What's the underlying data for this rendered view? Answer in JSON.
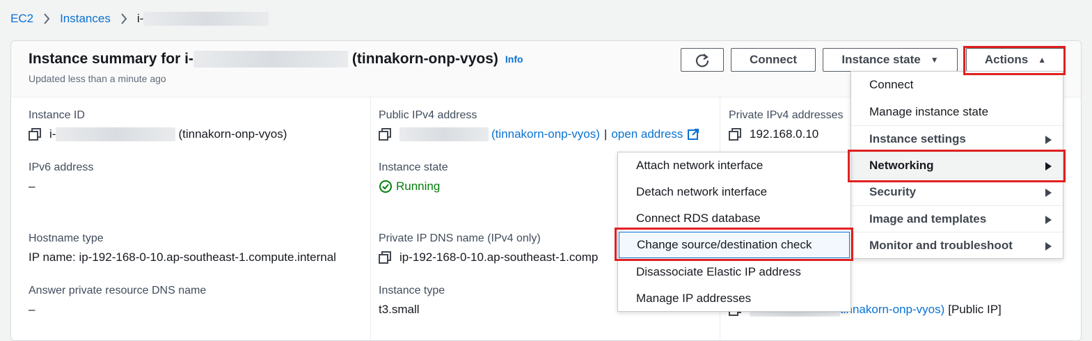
{
  "breadcrumb": {
    "ec2": "EC2",
    "instances": "Instances",
    "current_prefix": "i-"
  },
  "summary": {
    "title_prefix": "Instance summary for i-",
    "title_suffix": "(tinnakorn-onp-vyos)",
    "info": "Info",
    "updated": "Updated less than a minute ago"
  },
  "toolbar": {
    "refresh_icon": "refresh-icon",
    "connect": "Connect",
    "instance_state": "Instance state",
    "actions": "Actions"
  },
  "fields": {
    "instance_id": {
      "label": "Instance ID",
      "prefix": "i-",
      "suffix": "(tinnakorn-onp-vyos)"
    },
    "public_ipv4": {
      "label": "Public IPv4 address",
      "name": "(tinnakorn-onp-vyos)",
      "sep": "|",
      "open": "open address"
    },
    "private_ipv4": {
      "label": "Private IPv4 addresses",
      "value": "192.168.0.10"
    },
    "ipv6": {
      "label": "IPv6 address",
      "value": "–"
    },
    "state": {
      "label": "Instance state",
      "value": "Running"
    },
    "hostname_type": {
      "label": "Hostname type",
      "value": "IP name: ip-192-168-0-10.ap-southeast-1.compute.internal"
    },
    "private_dns": {
      "label": "Private IP DNS name (IPv4 only)",
      "value": "ip-192-168-0-10.ap-southeast-1.comp"
    },
    "answer_dns": {
      "label": "Answer private resource DNS name",
      "value": "–"
    },
    "instance_type": {
      "label": "Instance type",
      "value": "t3.small"
    },
    "elastic_ip": {
      "link": "tinnakorn-onp-vyos)",
      "suffix": "[Public IP]"
    }
  },
  "actions_menu": {
    "items": [
      "Connect",
      "Manage instance state",
      "Instance settings",
      "Networking",
      "Security",
      "Image and templates",
      "Monitor and troubleshoot"
    ]
  },
  "networking_menu": {
    "items": [
      "Attach network interface",
      "Detach network interface",
      "Connect RDS database",
      "Change source/destination check",
      "Disassociate Elastic IP address",
      "Manage IP addresses"
    ]
  },
  "colors": {
    "link": "#0972d3",
    "running": "#037f0c",
    "highlight": "#e02020"
  }
}
